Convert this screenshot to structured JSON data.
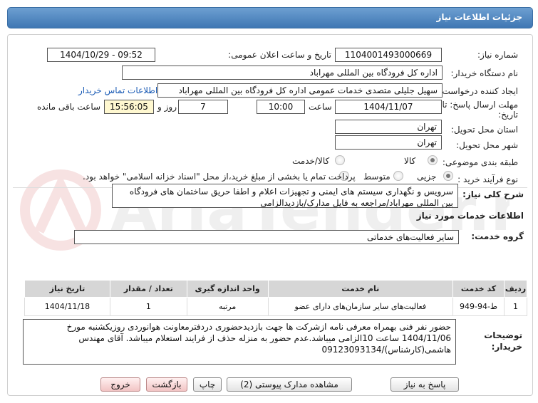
{
  "page_title": "جزئیات اطلاعات نیاز",
  "fields": {
    "need_number_label": "شماره نیاز:",
    "need_number": "1104001493000669",
    "announce_label": "تاریخ و ساعت اعلان عمومی:",
    "announce_value": "1404/10/29 - 09:52",
    "buyer_label": "نام دستگاه خریدار:",
    "buyer_value": "اداره کل فرودگاه بین المللی مهراباد",
    "creator_label": "ایجاد کننده درخواست:",
    "creator_value": "سهیل جلیلی متصدی خدمات عمومی اداره کل فرودگاه بین المللی مهراباد",
    "contact_link": "اطلاعات تماس خریدار",
    "deadline_label_1": "مهلت ارسال پاسخ: تا",
    "deadline_label_2": "تاریخ:",
    "deadline_date": "1404/11/07",
    "time_label": "ساعت",
    "deadline_time": "10:00",
    "days_value": "7",
    "days_label": "روز و",
    "remaining_time": "15:56:05",
    "remaining_label": "ساعت باقی مانده",
    "province_label": "استان محل تحویل:",
    "province_value": "تهران",
    "city_label": "شهر محل تحویل:",
    "city_value": "تهران",
    "category_label": "طبقه بندی موضوعی:",
    "category_options": [
      "کالا",
      "کالا/خدمت"
    ],
    "process_label": "نوع فرآیند خرید :",
    "process_options": [
      "جزیی",
      "متوسط"
    ],
    "process_note": "پرداخت تمام یا بخشی از مبلغ خرید،از محل \"اسناد خزانه اسلامی\" خواهد بود."
  },
  "summary": {
    "label": "شرح کلی نیاز:",
    "text": "سرویس و نگهداری سیستم های ایمنی و تجهیزات اعلام و اطفا حریق ساختمان های فرودگاه بین المللی مهراباد/مراجعه به فایل مدارک/بازدیدالزامی"
  },
  "services": {
    "section_title": "اطلاعات خدمات مورد نیاز",
    "group_label": "گروه خدمت:",
    "group_value": "سایر فعالیت‌های خدماتی",
    "columns": [
      "ردیف",
      "کد خدمت",
      "نام خدمت",
      "واحد اندازه گیری",
      "تعداد / مقدار",
      "تاریخ نیاز"
    ],
    "rows": [
      [
        "1",
        "ط-94-949",
        "فعالیت‌های سایر سازمان‌های دارای عضو",
        "مرتبه",
        "1",
        "1404/11/18"
      ]
    ]
  },
  "buyer_notes": {
    "label_1": "توضیحات",
    "label_2": "خریدار:",
    "text": "حضور نفر فنی بهمراه معرفی نامه ازشرکت ها جهت بازدیدحضوری دردفترمعاونت هوانوردی روزیکشنبه مورخ 1404/11/06 ساعت 10الزامی میباشد.عدم حضور به منزله حذف از فرایند استعلام میباشد. آقای مهندس هاشمی(کارشناس)/09123093134"
  },
  "buttons": {
    "reply": "پاسخ به نیاز",
    "attachments": "مشاهده مدارک پیوستی (2)",
    "print": "چاپ",
    "back": "بازگشت",
    "exit": "خروج"
  },
  "watermark": {
    "brand": "AriaTender.net"
  },
  "colors": {
    "title_bar": "#4a82bf",
    "table_header": "#d6d6d6",
    "watermark": "#c62828"
  }
}
